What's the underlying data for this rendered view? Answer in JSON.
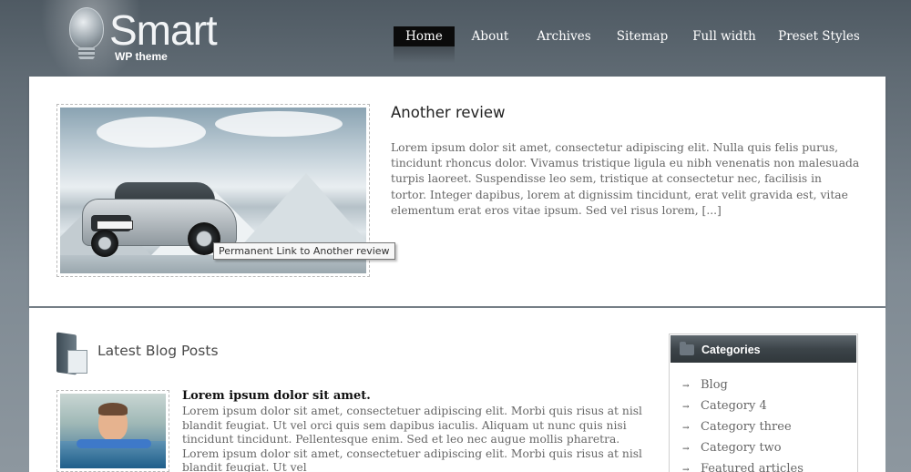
{
  "header": {
    "logo_title": "Smart",
    "logo_subtitle": "WP theme",
    "nav": [
      {
        "label": "Home",
        "active": true
      },
      {
        "label": "About",
        "active": false
      },
      {
        "label": "Archives",
        "active": false
      },
      {
        "label": "Sitemap",
        "active": false
      },
      {
        "label": "Full width",
        "active": false
      },
      {
        "label": "Preset Styles",
        "active": false
      }
    ]
  },
  "featured": {
    "title": "Another review",
    "tooltip": "Permanent Link to Another review",
    "excerpt": "Lorem ipsum dolor sit amet, consectetur adipiscing elit. Nulla quis felis purus, tincidunt rhoncus dolor. Vivamus tristique ligula eu nibh venenatis non malesuada turpis laoreet. Suspendisse leo sem, tristique at consectetur nec, facilisis in tortor. Integer dapibus, lorem at dignissim tincidunt, erat velit gravida est, vitae elementum erat eros vitae ipsum. Sed vel risus lorem, [...]"
  },
  "latest": {
    "heading": "Latest Blog Posts",
    "post_title": "Lorem ipsum dolor sit amet.",
    "post_excerpt": "Lorem ipsum dolor sit amet, consectetuer adipiscing elit. Morbi quis risus at nisl blandit feugiat. Ut vel orci quis sem dapibus iaculis. Aliquam ut nunc quis nisi tincidunt tincidunt. Pellentesque enim. Sed et leo nec augue mollis pharetra. Lorem ipsum dolor sit amet, consectetuer adipiscing elit. Morbi quis risus at nisl blandit feugiat. Ut vel"
  },
  "sidebar": {
    "title": "Categories",
    "categories": [
      "Blog",
      "Category 4",
      "Category three",
      "Category two",
      "Featured articles"
    ]
  }
}
